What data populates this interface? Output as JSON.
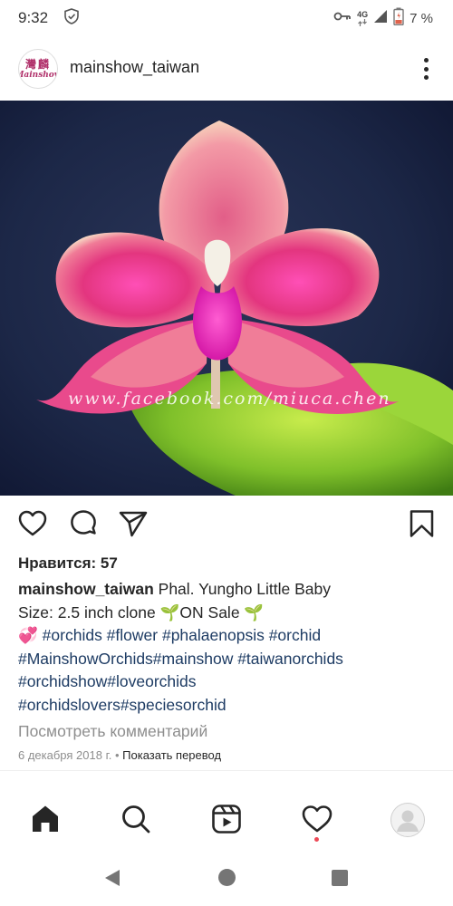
{
  "status_bar": {
    "time": "9:32",
    "network_type": "4G",
    "battery_percent": "7 %"
  },
  "post": {
    "username": "mainshow_taiwan",
    "avatar_text_top": "灣麟",
    "avatar_text_bottom": "Mainshow",
    "photo_watermark": "www.facebook.com/miuca.chen",
    "likes": "Нравится: 57",
    "caption_author": "mainshow_taiwan",
    "caption_lines": {
      "line1": "Phal. Yungho Little Baby",
      "line2": "Size: 2.5 inch clone 🌱ON Sale 🌱",
      "line3_emoji": "💞",
      "line3_tags": "#orchids #flower #phalaenopsis #orchid",
      "line4": "#MainshowOrchids#mainshow #taiwanorchids",
      "line5": "#orchidshow#loveorchids",
      "line6": "#orchidslovers#speciesorchid"
    },
    "view_comments": "Посмотреть комментарий",
    "date": "6 декабря 2018 г.",
    "separator": "•",
    "translate": "Показать перевод"
  },
  "icons": {
    "like": "heart-icon",
    "comment": "comment-icon",
    "share": "send-icon",
    "save": "bookmark-icon",
    "nav_home": "home-icon",
    "nav_search": "search-icon",
    "nav_reels": "reels-icon",
    "nav_activity": "heart-icon",
    "nav_profile": "profile-avatar",
    "sys_back": "back-triangle-icon",
    "sys_home": "home-circle-icon",
    "sys_recents": "recents-square-icon"
  },
  "colors": {
    "hashtag": "#1d3b63",
    "notification_dot": "#ed4956",
    "secondary_text": "#8e8e8e"
  }
}
